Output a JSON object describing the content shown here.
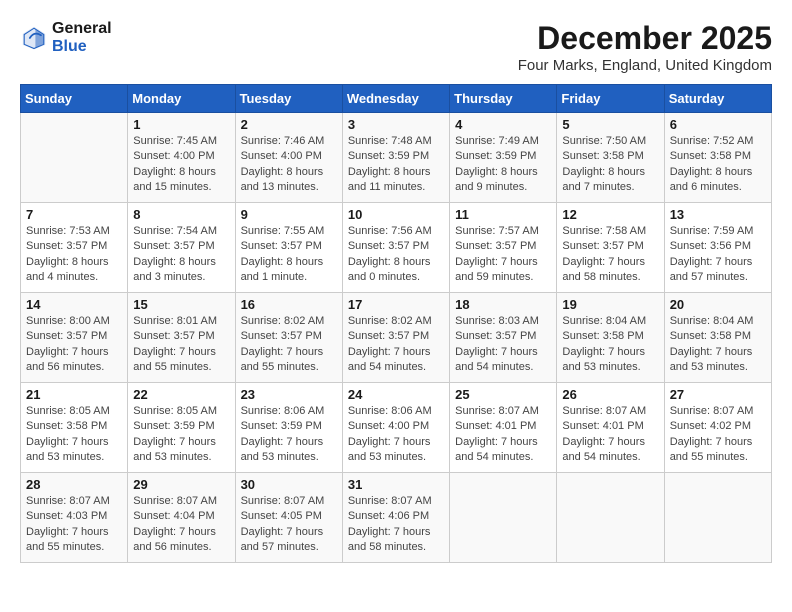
{
  "header": {
    "logo_line1": "General",
    "logo_line2": "Blue",
    "title": "December 2025",
    "location": "Four Marks, England, United Kingdom"
  },
  "weekdays": [
    "Sunday",
    "Monday",
    "Tuesday",
    "Wednesday",
    "Thursday",
    "Friday",
    "Saturday"
  ],
  "weeks": [
    [
      {
        "day": "",
        "content": ""
      },
      {
        "day": "1",
        "content": "Sunrise: 7:45 AM\nSunset: 4:00 PM\nDaylight: 8 hours\nand 15 minutes."
      },
      {
        "day": "2",
        "content": "Sunrise: 7:46 AM\nSunset: 4:00 PM\nDaylight: 8 hours\nand 13 minutes."
      },
      {
        "day": "3",
        "content": "Sunrise: 7:48 AM\nSunset: 3:59 PM\nDaylight: 8 hours\nand 11 minutes."
      },
      {
        "day": "4",
        "content": "Sunrise: 7:49 AM\nSunset: 3:59 PM\nDaylight: 8 hours\nand 9 minutes."
      },
      {
        "day": "5",
        "content": "Sunrise: 7:50 AM\nSunset: 3:58 PM\nDaylight: 8 hours\nand 7 minutes."
      },
      {
        "day": "6",
        "content": "Sunrise: 7:52 AM\nSunset: 3:58 PM\nDaylight: 8 hours\nand 6 minutes."
      }
    ],
    [
      {
        "day": "7",
        "content": "Sunrise: 7:53 AM\nSunset: 3:57 PM\nDaylight: 8 hours\nand 4 minutes."
      },
      {
        "day": "8",
        "content": "Sunrise: 7:54 AM\nSunset: 3:57 PM\nDaylight: 8 hours\nand 3 minutes."
      },
      {
        "day": "9",
        "content": "Sunrise: 7:55 AM\nSunset: 3:57 PM\nDaylight: 8 hours\nand 1 minute."
      },
      {
        "day": "10",
        "content": "Sunrise: 7:56 AM\nSunset: 3:57 PM\nDaylight: 8 hours\nand 0 minutes."
      },
      {
        "day": "11",
        "content": "Sunrise: 7:57 AM\nSunset: 3:57 PM\nDaylight: 7 hours\nand 59 minutes."
      },
      {
        "day": "12",
        "content": "Sunrise: 7:58 AM\nSunset: 3:57 PM\nDaylight: 7 hours\nand 58 minutes."
      },
      {
        "day": "13",
        "content": "Sunrise: 7:59 AM\nSunset: 3:56 PM\nDaylight: 7 hours\nand 57 minutes."
      }
    ],
    [
      {
        "day": "14",
        "content": "Sunrise: 8:00 AM\nSunset: 3:57 PM\nDaylight: 7 hours\nand 56 minutes."
      },
      {
        "day": "15",
        "content": "Sunrise: 8:01 AM\nSunset: 3:57 PM\nDaylight: 7 hours\nand 55 minutes."
      },
      {
        "day": "16",
        "content": "Sunrise: 8:02 AM\nSunset: 3:57 PM\nDaylight: 7 hours\nand 55 minutes."
      },
      {
        "day": "17",
        "content": "Sunrise: 8:02 AM\nSunset: 3:57 PM\nDaylight: 7 hours\nand 54 minutes."
      },
      {
        "day": "18",
        "content": "Sunrise: 8:03 AM\nSunset: 3:57 PM\nDaylight: 7 hours\nand 54 minutes."
      },
      {
        "day": "19",
        "content": "Sunrise: 8:04 AM\nSunset: 3:58 PM\nDaylight: 7 hours\nand 53 minutes."
      },
      {
        "day": "20",
        "content": "Sunrise: 8:04 AM\nSunset: 3:58 PM\nDaylight: 7 hours\nand 53 minutes."
      }
    ],
    [
      {
        "day": "21",
        "content": "Sunrise: 8:05 AM\nSunset: 3:58 PM\nDaylight: 7 hours\nand 53 minutes."
      },
      {
        "day": "22",
        "content": "Sunrise: 8:05 AM\nSunset: 3:59 PM\nDaylight: 7 hours\nand 53 minutes."
      },
      {
        "day": "23",
        "content": "Sunrise: 8:06 AM\nSunset: 3:59 PM\nDaylight: 7 hours\nand 53 minutes."
      },
      {
        "day": "24",
        "content": "Sunrise: 8:06 AM\nSunset: 4:00 PM\nDaylight: 7 hours\nand 53 minutes."
      },
      {
        "day": "25",
        "content": "Sunrise: 8:07 AM\nSunset: 4:01 PM\nDaylight: 7 hours\nand 54 minutes."
      },
      {
        "day": "26",
        "content": "Sunrise: 8:07 AM\nSunset: 4:01 PM\nDaylight: 7 hours\nand 54 minutes."
      },
      {
        "day": "27",
        "content": "Sunrise: 8:07 AM\nSunset: 4:02 PM\nDaylight: 7 hours\nand 55 minutes."
      }
    ],
    [
      {
        "day": "28",
        "content": "Sunrise: 8:07 AM\nSunset: 4:03 PM\nDaylight: 7 hours\nand 55 minutes."
      },
      {
        "day": "29",
        "content": "Sunrise: 8:07 AM\nSunset: 4:04 PM\nDaylight: 7 hours\nand 56 minutes."
      },
      {
        "day": "30",
        "content": "Sunrise: 8:07 AM\nSunset: 4:05 PM\nDaylight: 7 hours\nand 57 minutes."
      },
      {
        "day": "31",
        "content": "Sunrise: 8:07 AM\nSunset: 4:06 PM\nDaylight: 7 hours\nand 58 minutes."
      },
      {
        "day": "",
        "content": ""
      },
      {
        "day": "",
        "content": ""
      },
      {
        "day": "",
        "content": ""
      }
    ]
  ]
}
